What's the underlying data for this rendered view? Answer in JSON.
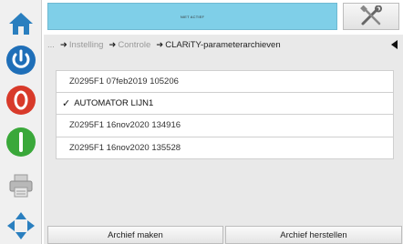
{
  "sidebar": {
    "buttons": [
      {
        "name": "home-icon",
        "color": "#2a7fbf"
      },
      {
        "name": "power-icon",
        "color": "#1f6fb8"
      },
      {
        "name": "stop-icon",
        "color": "#d83a2a"
      },
      {
        "name": "start-icon",
        "color": "#3aa83a"
      },
      {
        "name": "printer-icon",
        "color": "#9a9a9a"
      },
      {
        "name": "navigate-icon",
        "color": "#2a7fbf"
      }
    ]
  },
  "header": {
    "status": "NIET ACTIEF",
    "accent": "#7fcfe8"
  },
  "breadcrumb": {
    "ellipsis": "...",
    "items": [
      "Instelling",
      "Controle",
      "CLARiTY-parameterarchieven"
    ]
  },
  "archives": {
    "items": [
      {
        "label": "Z0295F1 07feb2019 105206",
        "selected": false
      },
      {
        "label": "AUTOMATOR LIJN1",
        "selected": true
      },
      {
        "label": "Z0295F1 16nov2020 134916",
        "selected": false
      },
      {
        "label": "Z0295F1 16nov2020 135528",
        "selected": false
      }
    ]
  },
  "footer": {
    "create_label": "Archief maken",
    "restore_label": "Archief herstellen"
  }
}
